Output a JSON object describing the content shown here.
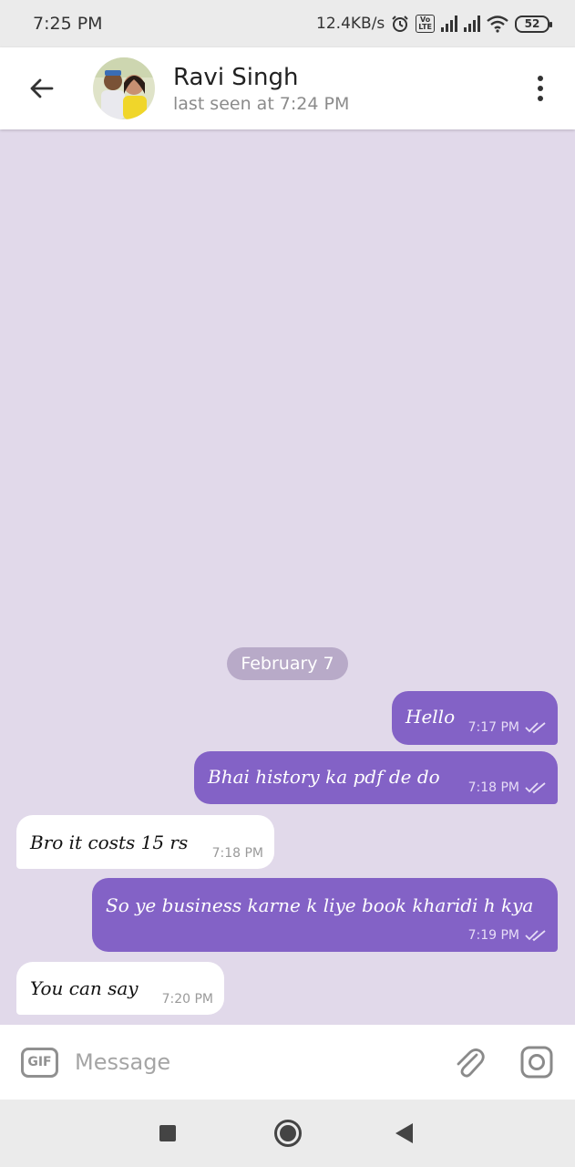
{
  "status_bar": {
    "time": "7:25 PM",
    "network_speed": "12.4KB/s",
    "volte_label": "Vo\nLTE",
    "battery": "52",
    "icons": [
      "alarm-icon",
      "volte-icon",
      "signal-icon",
      "signal-icon",
      "wifi-icon",
      "battery-icon"
    ]
  },
  "header": {
    "contact_name": "Ravi Singh",
    "last_seen": "last seen at 7:24 PM",
    "icons": [
      "back-arrow-icon",
      "avatar",
      "more-vertical-icon"
    ]
  },
  "chat": {
    "date_label": "February 7",
    "messages": [
      {
        "direction": "outgoing",
        "text": "Hello",
        "time": "7:17 PM",
        "read": true
      },
      {
        "direction": "outgoing",
        "text": "Bhai history ka pdf de do",
        "time": "7:18 PM",
        "read": true
      },
      {
        "direction": "incoming",
        "text": "Bro it costs 15 rs",
        "time": "7:18 PM"
      },
      {
        "direction": "outgoing",
        "text": "So ye business karne k liye book kharidi h kya",
        "time": "7:19 PM",
        "read": true
      },
      {
        "direction": "incoming",
        "text": "You can say",
        "time": "7:20 PM"
      }
    ]
  },
  "input_bar": {
    "gif_label": "GIF",
    "placeholder": "Message",
    "value": "",
    "icons": [
      "attach-icon",
      "camera-icon"
    ]
  },
  "colors": {
    "chat_background": "#e1d9ea",
    "outgoing_bubble": "#8362c6",
    "incoming_bubble": "#ffffff",
    "date_pill": "#b8aac8"
  }
}
